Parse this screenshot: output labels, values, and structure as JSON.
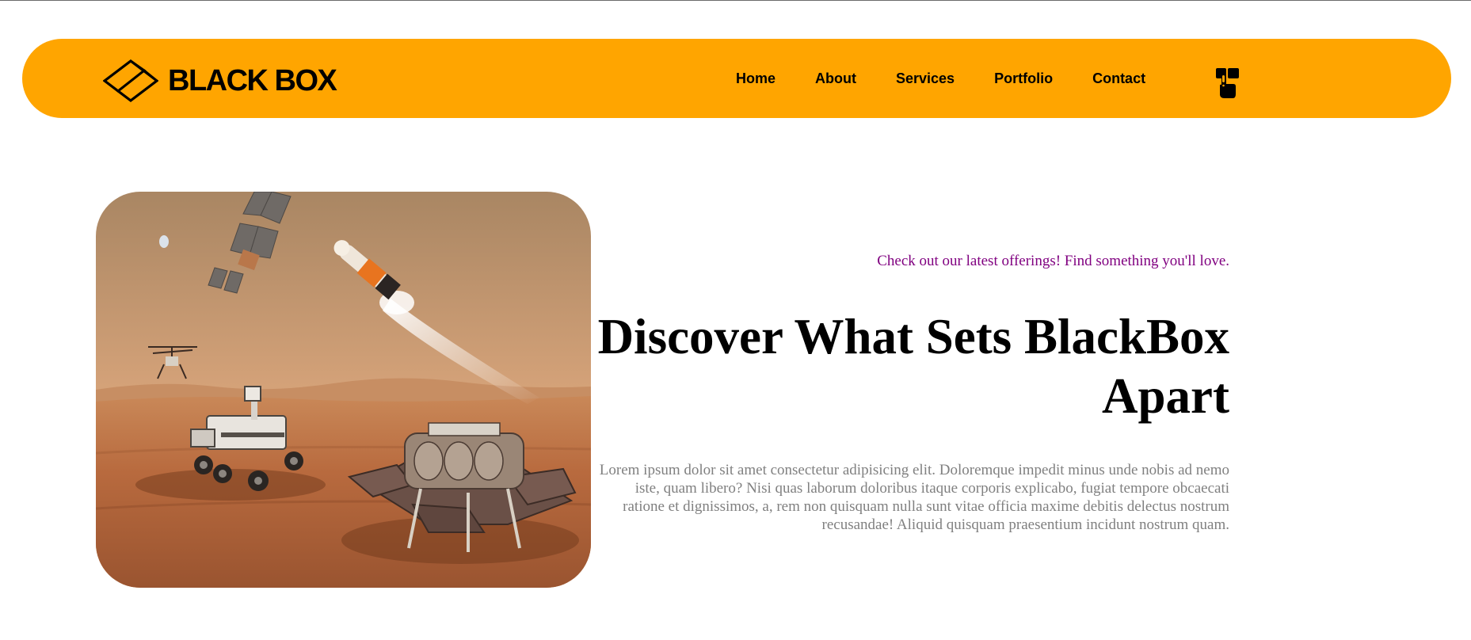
{
  "brand": {
    "name": "BLACK BOX",
    "logo_icon": "diamond-box-logo"
  },
  "nav": {
    "links": [
      {
        "label": "Home"
      },
      {
        "label": "About"
      },
      {
        "label": "Services"
      },
      {
        "label": "Portfolio"
      },
      {
        "label": "Contact"
      }
    ],
    "menu_icon": "hand-pointer-icon"
  },
  "hero": {
    "tagline": "Check out our latest offerings! Find something you'll love.",
    "headline": "Discover What Sets BlackBox Apart",
    "body": "Lorem ipsum dolor sit amet consectetur adipisicing elit. Doloremque impedit minus unde nobis ad nemo iste, quam libero? Nisi quas laborum doloribus itaque corporis explicabo, fugiat tempore obcaecati ratione et dignissimos, a, rem non quisquam nulla sunt vitae officia maxime debitis delectus nostrum recusandae! Aliquid quisquam praesentium incidunt nostrum quam."
  },
  "colors": {
    "navbar": "#ffa500",
    "tagline": "#800080",
    "body_text": "#808080",
    "headline": "#000000"
  }
}
